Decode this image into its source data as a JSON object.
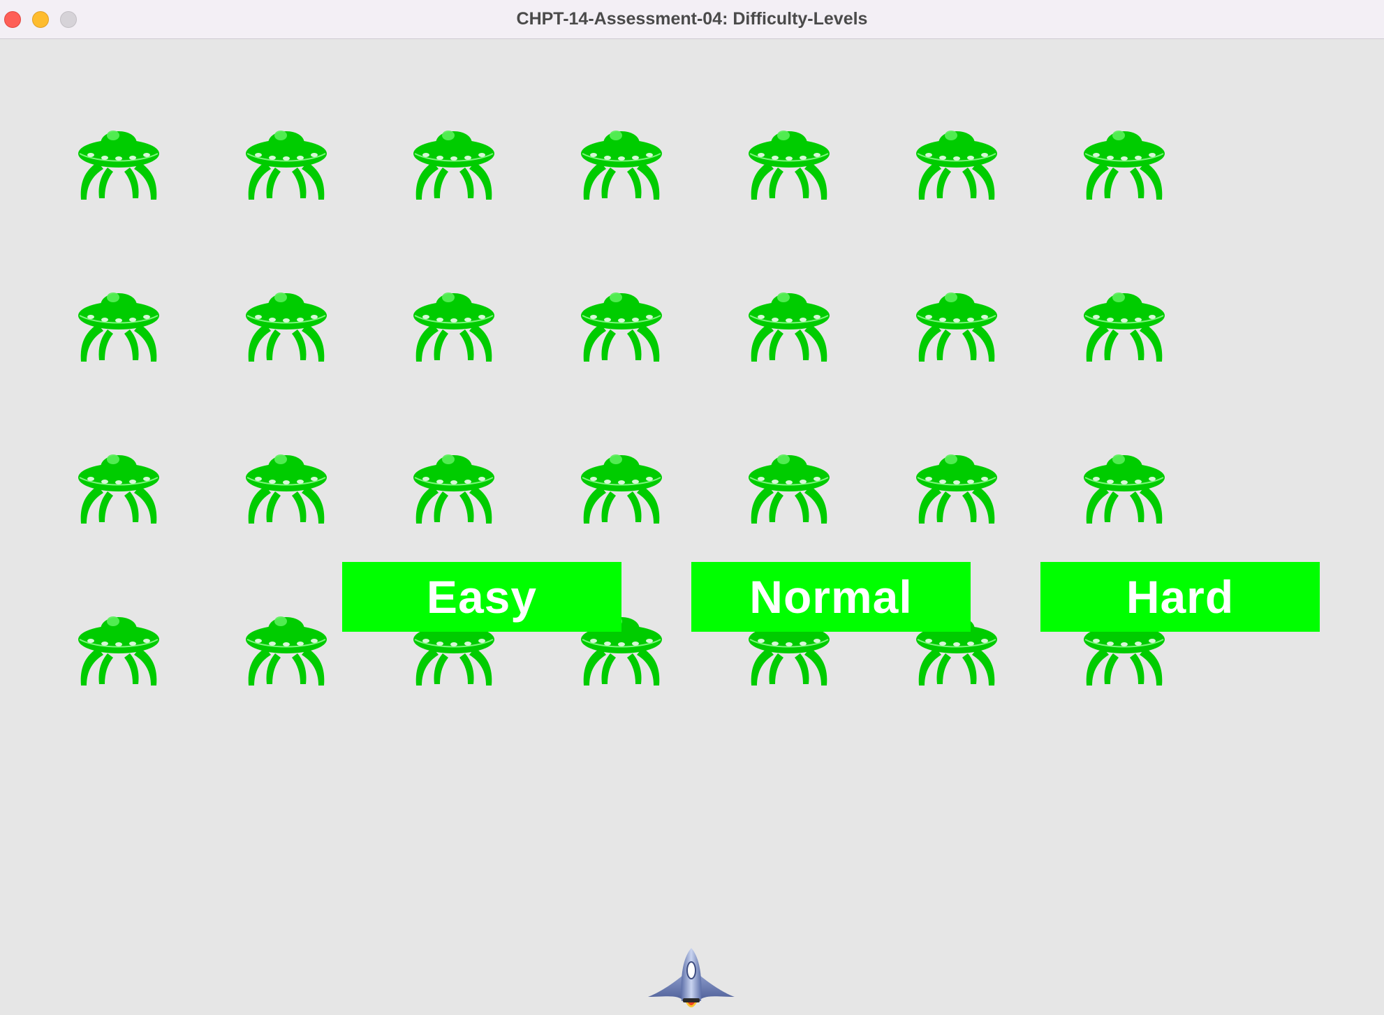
{
  "window": {
    "title": "CHPT-14-Assessment-04: Difficulty-Levels",
    "controls": [
      "close-icon",
      "minimize-icon",
      "zoom-icon"
    ]
  },
  "game": {
    "background_color": "#e6e6e6",
    "alien_color": "#00cc00",
    "alien_icon": "green-ufo-alien-icon",
    "alien_grid": {
      "rows": 4,
      "columns": 7
    },
    "player_icon": "spaceship-icon"
  },
  "difficulty_buttons": [
    {
      "label": "Easy"
    },
    {
      "label": "Normal"
    },
    {
      "label": "Hard"
    }
  ],
  "button_color": "#00ff00",
  "button_text_color": "#ffffff"
}
